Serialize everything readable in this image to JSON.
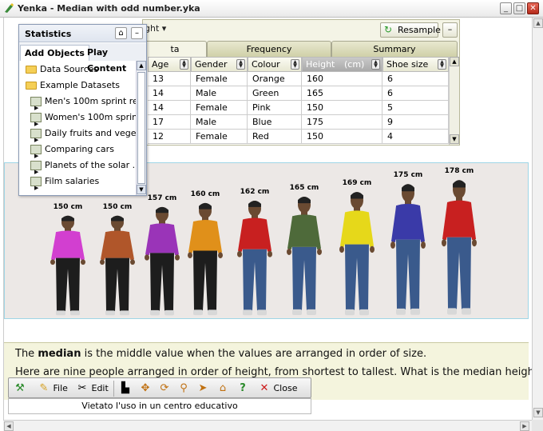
{
  "window": {
    "title": "Yenka - Median with odd number.yka",
    "controls": [
      "_",
      "□",
      "✕"
    ]
  },
  "table_panel": {
    "dropdown_label": "ght",
    "resample_label": "Resample",
    "tabs": [
      "ta",
      "Frequency",
      "Summary"
    ],
    "columns": [
      "Age",
      "Gender",
      "Colour",
      "Height",
      "(cm)",
      "Shoe size"
    ],
    "rows": [
      [
        "13",
        "Female",
        "Orange",
        "160",
        "6"
      ],
      [
        "14",
        "Male",
        "Green",
        "165",
        "6"
      ],
      [
        "14",
        "Female",
        "Pink",
        "150",
        "5"
      ],
      [
        "17",
        "Male",
        "Blue",
        "175",
        "9"
      ],
      [
        "12",
        "Female",
        "Red",
        "150",
        "4"
      ]
    ]
  },
  "statistics_panel": {
    "title": "Statistics",
    "tabs": [
      "Add Objects",
      "Play Content"
    ],
    "tree": [
      {
        "label": "Data Sources",
        "type": "folder"
      },
      {
        "label": "Example Datasets",
        "type": "folder-open"
      },
      {
        "label": "Men's 100m sprint re...",
        "type": "dataset"
      },
      {
        "label": "Women's 100m sprint...",
        "type": "dataset"
      },
      {
        "label": "Daily fruits and vege...",
        "type": "dataset"
      },
      {
        "label": "Comparing cars",
        "type": "dataset"
      },
      {
        "label": "Planets of the solar ...",
        "type": "dataset"
      },
      {
        "label": "Film salaries",
        "type": "dataset"
      }
    ]
  },
  "people": [
    {
      "height": "150 cm",
      "shirt": "#d23fd0",
      "pants": "#1d1d1d"
    },
    {
      "height": "150 cm",
      "shirt": "#b0562a",
      "pants": "#1d1d1d"
    },
    {
      "height": "157 cm",
      "shirt": "#9a34b8",
      "pants": "#1d1d1d"
    },
    {
      "height": "160 cm",
      "shirt": "#e0901a",
      "pants": "#1d1d1d"
    },
    {
      "height": "162 cm",
      "shirt": "#c82020",
      "pants": "#3a5a8c"
    },
    {
      "height": "165 cm",
      "shirt": "#4e6a3a",
      "pants": "#3a5a8c"
    },
    {
      "height": "169 cm",
      "shirt": "#e6d81a",
      "pants": "#3a5a8c"
    },
    {
      "height": "175 cm",
      "shirt": "#3a3aa8",
      "pants": "#3a5a8c"
    },
    {
      "height": "178 cm",
      "shirt": "#c82020",
      "pants": "#3a5a8c"
    }
  ],
  "text": {
    "line1_prefix": "The ",
    "line1_bold": "median",
    "line1_suffix": " is the middle value when the values are arranged in order of size.",
    "line2": "Here are nine people arranged in order of height, from shortest to tallest. What is the median height in"
  },
  "toolbar": {
    "file_label": "File",
    "edit_label": "Edit",
    "close_label": "Close",
    "icons": [
      "wand-icon",
      "file-icon",
      "scissors-icon",
      "save-icon",
      "move-icon",
      "rotate-icon",
      "zoom-icon",
      "pointer-icon",
      "home-icon",
      "help-icon",
      "close-icon"
    ]
  },
  "footer": {
    "notice": "Vietato l'uso in un centro educativo"
  }
}
